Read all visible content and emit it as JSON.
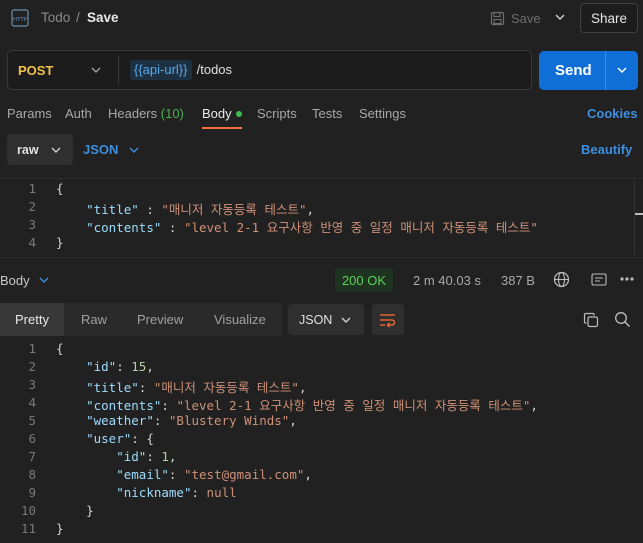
{
  "header": {
    "breadcrumb_parent": "Todo",
    "breadcrumb_sep": "/",
    "breadcrumb_current": "Save",
    "save_label": "Save",
    "share_label": "Share",
    "http_icon_text": "HTTP"
  },
  "request": {
    "method": "POST",
    "url_variable": "{{api-url}}",
    "url_path": " /todos",
    "send_label": "Send"
  },
  "tabs": {
    "params": "Params",
    "auth": "Auth",
    "headers": "Headers",
    "headers_count": "(10)",
    "body": "Body",
    "scripts": "Scripts",
    "tests": "Tests",
    "settings": "Settings",
    "cookies": "Cookies"
  },
  "body_options": {
    "mode": "raw",
    "language": "JSON",
    "beautify": "Beautify"
  },
  "request_body": {
    "line_numbers": [
      "1",
      "2",
      "3",
      "4"
    ],
    "title_key": "\"title\"",
    "title_value": "\"매니저 자동등록 테스트\"",
    "contents_key": "\"contents\"",
    "contents_value": "\"level 2-1 요구사항 반영 중 일정 매니저 자동등록 테스트\""
  },
  "response": {
    "title": "Body",
    "status": "200 OK",
    "time": "2 m 40.03 s",
    "size": "387 B",
    "view_tabs": [
      "Pretty",
      "Raw",
      "Preview",
      "Visualize"
    ],
    "format": "JSON",
    "line_numbers": [
      "1",
      "2",
      "3",
      "4",
      "5",
      "6",
      "7",
      "8",
      "9",
      "10",
      "11"
    ],
    "id_key": "\"id\"",
    "id_value": "15",
    "title_key": "\"title\"",
    "title_value": "\"매니저 자동등록 테스트\"",
    "contents_key": "\"contents\"",
    "contents_value": "\"level 2-1 요구사항 반영 중 일정 매니저 자동등록 테스트\"",
    "weather_key": "\"weather\"",
    "weather_value": "\"Blustery Winds\"",
    "user_key": "\"user\"",
    "user_id_key": "\"id\"",
    "user_id_value": "1",
    "email_key": "\"email\"",
    "email_value": "\"test@gmail.com\"",
    "nickname_key": "\"nickname\"",
    "nickname_value": "null"
  },
  "colors": {
    "accent_orange": "#ff6c37",
    "send_blue": "#0f6fd6",
    "link_blue": "#3d8fe0",
    "status_green": "#5bd15b",
    "method_yellow": "#f0c14b"
  },
  "icons": [
    "http-icon",
    "save-icon",
    "chevron-down-icon",
    "globe-icon",
    "save-response-icon",
    "more-icon",
    "wrap-icon",
    "copy-icon",
    "search-icon"
  ]
}
